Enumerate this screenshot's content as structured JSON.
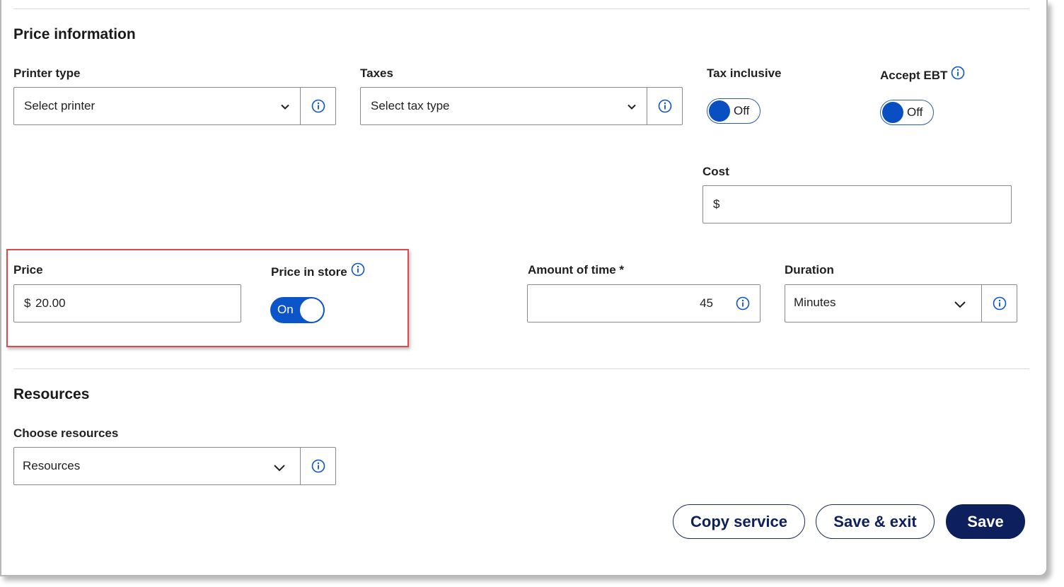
{
  "price_information": {
    "title": "Price information",
    "printer_type": {
      "label": "Printer type",
      "value": "Select printer"
    },
    "taxes": {
      "label": "Taxes",
      "value": "Select tax type"
    },
    "tax_inclusive": {
      "label": "Tax inclusive",
      "toggle_state": "Off"
    },
    "accept_ebt": {
      "label": "Accept EBT",
      "toggle_state": "Off"
    },
    "cost": {
      "label": "Cost",
      "prefix": "$",
      "value": ""
    },
    "price": {
      "label": "Price",
      "prefix": "$",
      "value": "20.00"
    },
    "price_in_store": {
      "label": "Price in store",
      "toggle_state": "On"
    },
    "amount_of_time": {
      "label": "Amount of time *",
      "value": "45"
    },
    "duration": {
      "label": "Duration",
      "value": "Minutes"
    }
  },
  "resources": {
    "title": "Resources",
    "choose_resources": {
      "label": "Choose resources",
      "value": "Resources"
    }
  },
  "actions": {
    "copy_service": "Copy service",
    "save_exit": "Save & exit",
    "save": "Save"
  },
  "colors": {
    "accent_blue": "#0b55c9",
    "navy": "#0d1f5c",
    "highlight_red": "#e0484c"
  }
}
